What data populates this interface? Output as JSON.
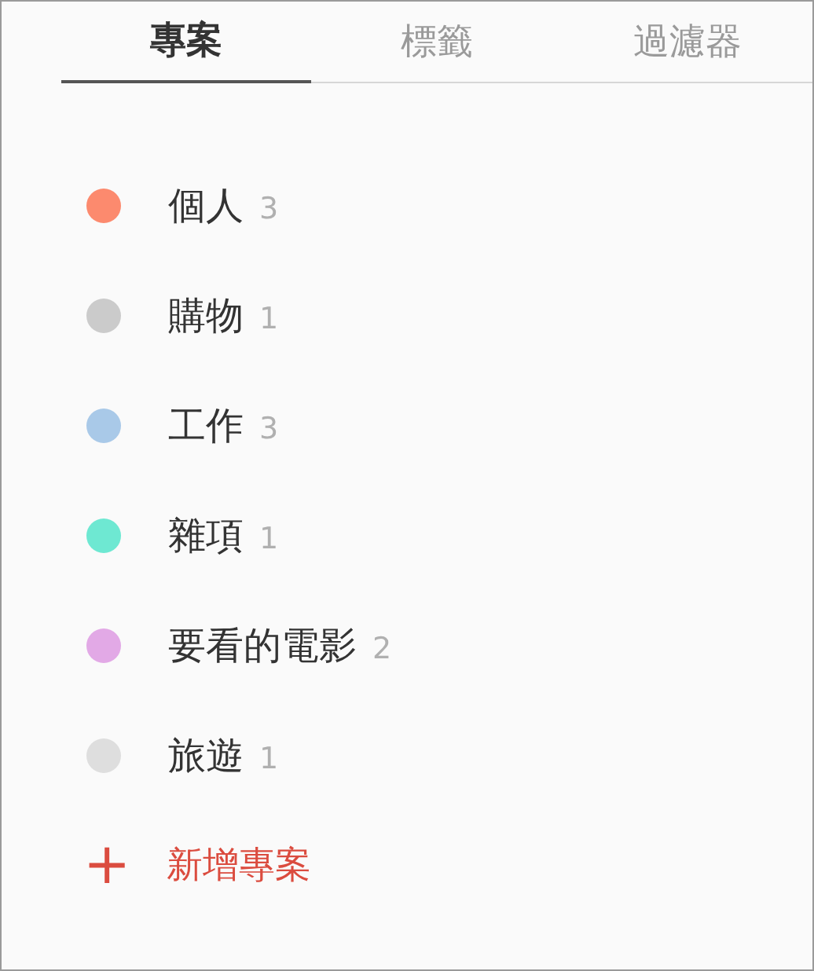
{
  "tabs": [
    {
      "label": "專案",
      "selected": true
    },
    {
      "label": "標籤",
      "selected": false
    },
    {
      "label": "過濾器",
      "selected": false
    }
  ],
  "projects": [
    {
      "name": "個人",
      "count": "3",
      "color": "#fc8a6e"
    },
    {
      "name": "購物",
      "count": "1",
      "color": "#cbcbcb"
    },
    {
      "name": "工作",
      "count": "3",
      "color": "#a9c9e8"
    },
    {
      "name": "雜項",
      "count": "1",
      "color": "#6ee8d2"
    },
    {
      "name": "要看的電影",
      "count": "2",
      "color": "#e2a9e6"
    },
    {
      "name": "旅遊",
      "count": "1",
      "color": "#dedede"
    }
  ],
  "add_project": {
    "icon": "+",
    "label": "新增專案"
  }
}
